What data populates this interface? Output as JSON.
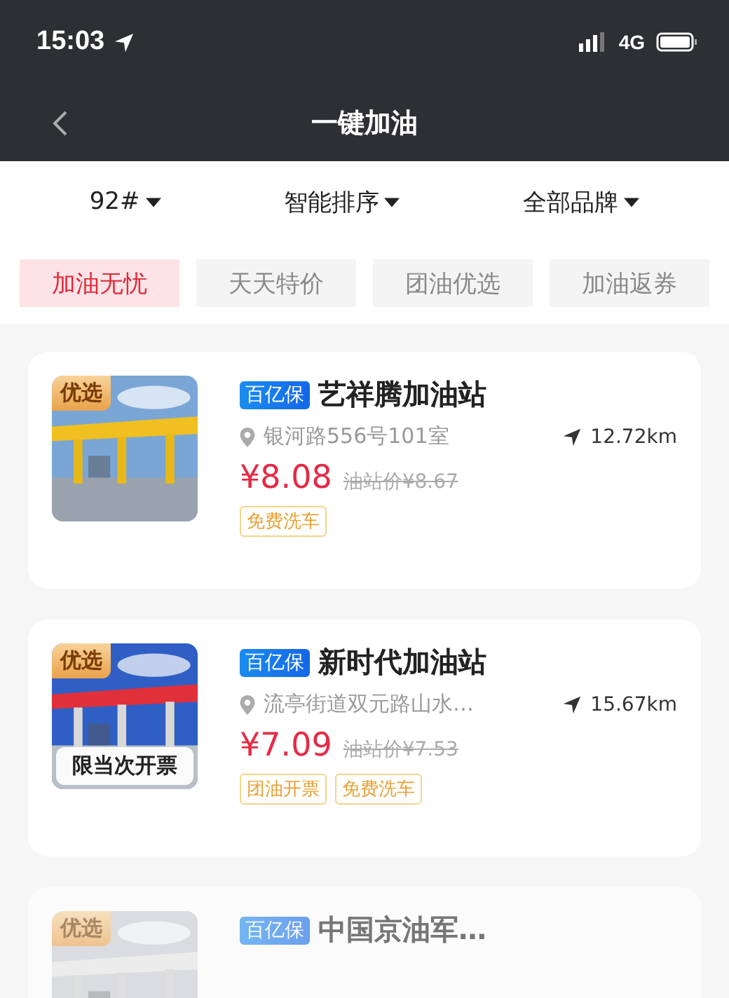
{
  "status_bar": {
    "time": "15:03",
    "network": "4G"
  },
  "nav": {
    "title": "一键加油"
  },
  "filters": [
    {
      "label": "92#"
    },
    {
      "label": "智能排序"
    },
    {
      "label": "全部品牌"
    }
  ],
  "chips": [
    {
      "label": "加油无忧",
      "selected": true
    },
    {
      "label": "天天特价",
      "selected": false
    },
    {
      "label": "团油优选",
      "selected": false
    },
    {
      "label": "加油返券",
      "selected": false
    }
  ],
  "stations": [
    {
      "photo_badge": "优选",
      "brand_badge": "百亿保",
      "name": "艺祥腾加油站",
      "address": "银河路556号101室",
      "distance": "12.72km",
      "price": "¥8.08",
      "original_price": "油站价¥8.67",
      "tags": [
        "免费洗车"
      ],
      "faded": false
    },
    {
      "photo_badge": "优选",
      "photo_caption": "限当次开票",
      "brand_badge": "百亿保",
      "name": "新时代加油站",
      "address": "流亭街道双元路山水…",
      "distance": "15.67km",
      "price": "¥7.09",
      "original_price": "油站价¥7.53",
      "tags": [
        "团油开票",
        "免费洗车"
      ],
      "faded": false
    },
    {
      "photo_badge": "优选",
      "brand_badge": "百亿保",
      "name": "中国京油军…",
      "faded": true
    }
  ]
}
